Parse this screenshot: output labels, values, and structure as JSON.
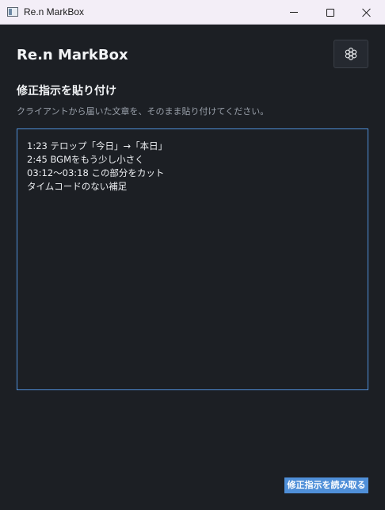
{
  "window": {
    "title": "Re.n MarkBox",
    "minimize_icon": "minimize-icon",
    "maximize_icon": "maximize-icon",
    "close_icon": "close-icon"
  },
  "header": {
    "app_title": "Re.n MarkBox",
    "settings_icon": "gear-icon"
  },
  "main": {
    "section_heading": "修正指示を貼り付け",
    "section_hint": "クライアントから届いた文章を、そのまま貼り付けてください。",
    "paste_text": "1:23 テロップ「今日」→「本日」\n2:45 BGMをもう少し小さく\n03:12〜03:18 この部分をカット\nタイムコードのない補足",
    "read_button_label": "修正指示を読み取る"
  },
  "colors": {
    "background": "#1c1f24",
    "accent": "#4f8fd8",
    "titlebar": "#f3eef7"
  }
}
